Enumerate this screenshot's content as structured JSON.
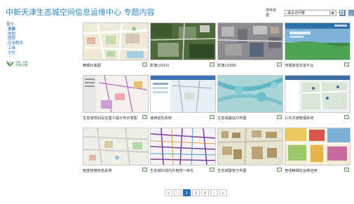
{
  "header": {
    "title": "中新天津生态城空间信息运维中心 专题内容"
  },
  "sort": {
    "label": "排序依据：",
    "selected": "最近访问量"
  },
  "view_toggle": {
    "grid_icon": "grid-icon",
    "list_icon": "list-icon"
  },
  "sidebar": {
    "heading": "显示",
    "items": [
      {
        "label": "全部",
        "active": true
      },
      {
        "label": "地图"
      },
      {
        "label": "图层"
      },
      {
        "label": "应用程序"
      },
      {
        "label": "工具"
      },
      {
        "label": "文件"
      }
    ]
  },
  "logo": {
    "line1": "中新 · 天津",
    "line2": "天津生态城"
  },
  "items": [
    {
      "title": "精细化底图",
      "thumb": "map-vector"
    },
    {
      "title": "影像(2010)",
      "thumb": "satellite-green"
    },
    {
      "title": "影像(2008)",
      "thumb": "satellite-urban"
    },
    {
      "title": "地理信息共享平台",
      "thumb": "portal"
    },
    {
      "title": "生态城规划及在建工程分布示意图",
      "thumb": "planning"
    },
    {
      "title": "通用巡检系统",
      "thumb": "patrol"
    },
    {
      "title": "生态城基站分布图",
      "thumb": "basestation"
    },
    {
      "title": "公共交通管理系统",
      "thumb": "transit"
    },
    {
      "title": "智能管廊信息系统",
      "thumb": "pipe-corridor"
    },
    {
      "title": "生态城红线内外管线一体化",
      "thumb": "pipelines"
    },
    {
      "title": "生态城建筑分布图",
      "thumb": "buildings"
    },
    {
      "title": "管线精细化运维应用",
      "thumb": "pipe-ops"
    }
  ],
  "pagination": {
    "first": "«",
    "prev": "‹",
    "pages": [
      "1",
      "2",
      "3"
    ],
    "current": "1",
    "next": "›",
    "last": "»"
  },
  "colors": {
    "title": "#2d88bd",
    "link": "#2a6fb5",
    "pager_active": "#2b6fb8"
  }
}
